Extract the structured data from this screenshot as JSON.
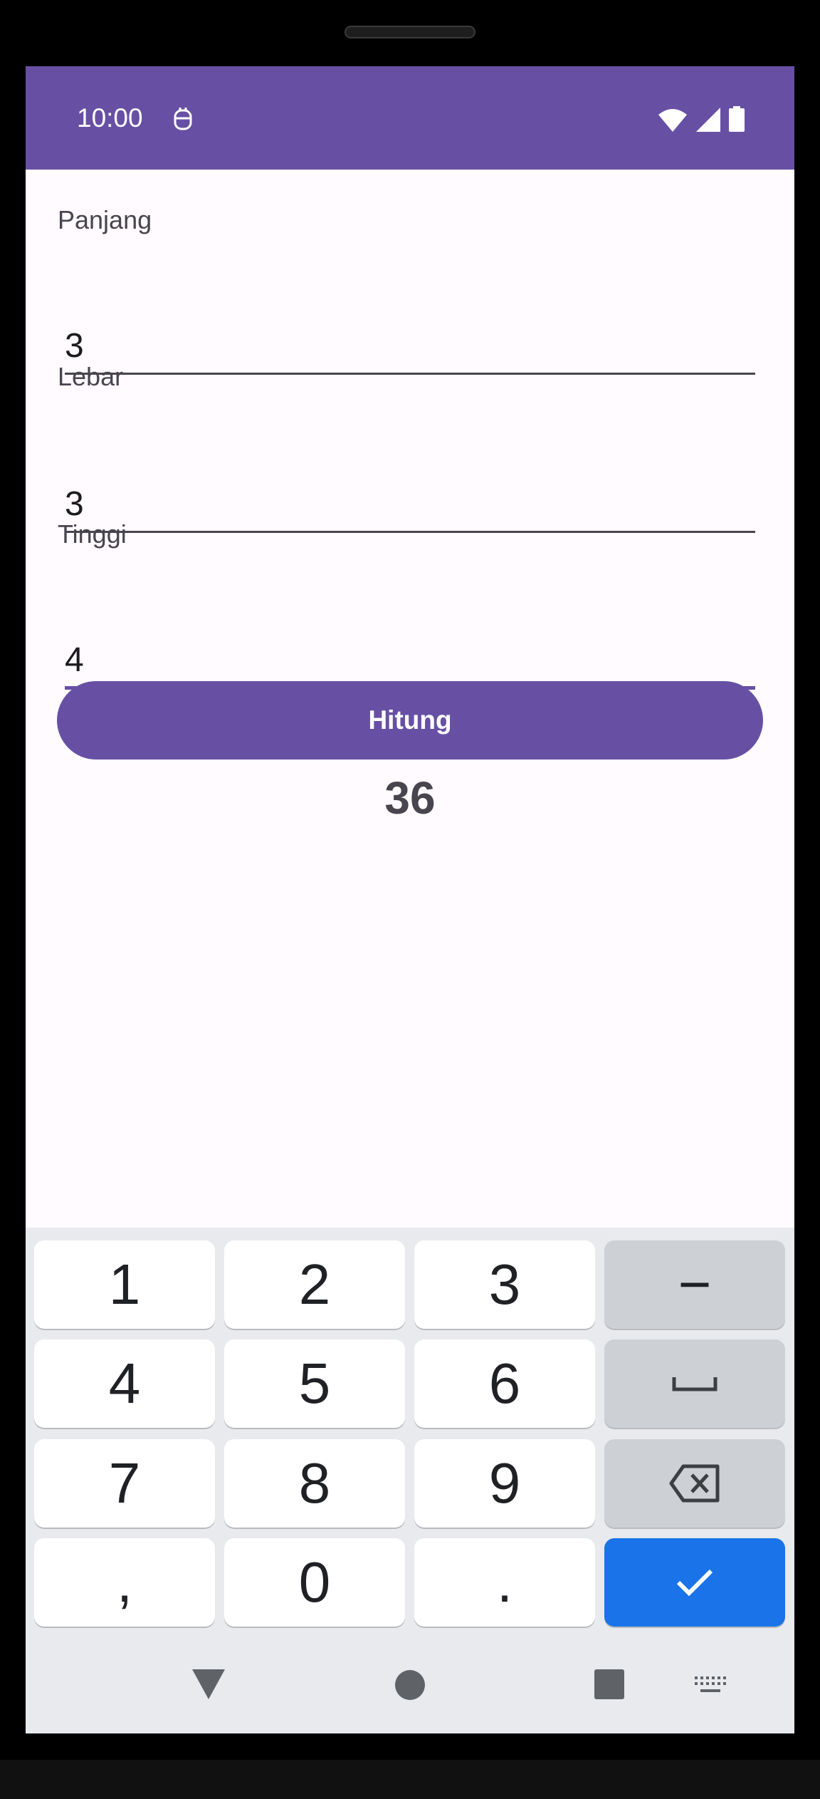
{
  "status_bar": {
    "time": "10:00",
    "icons": [
      "dnd-icon",
      "wifi-icon",
      "signal-icon",
      "battery-icon"
    ],
    "color": "#6750a4"
  },
  "form": {
    "length": {
      "label": "Panjang",
      "value": "3"
    },
    "width": {
      "label": "Lebar",
      "value": "3"
    },
    "height": {
      "label": "Tinggi",
      "value": "4"
    }
  },
  "button": {
    "label": "Hitung",
    "color": "#6750a4"
  },
  "result": "36",
  "keyboard": {
    "keys": {
      "k1": "1",
      "k2": "2",
      "k3": "3",
      "minus": "−",
      "k4": "4",
      "k5": "5",
      "k6": "6",
      "k7": "7",
      "k8": "8",
      "k9": "9",
      "comma": ",",
      "k0": "0",
      "period": "."
    },
    "icons": [
      "space-icon",
      "backspace-icon",
      "checkmark-icon",
      "keyboard-switch-icon"
    ],
    "enter_color": "#1a73e8"
  },
  "navigation": {
    "icons": [
      "back-icon",
      "home-icon",
      "recents-icon"
    ]
  }
}
